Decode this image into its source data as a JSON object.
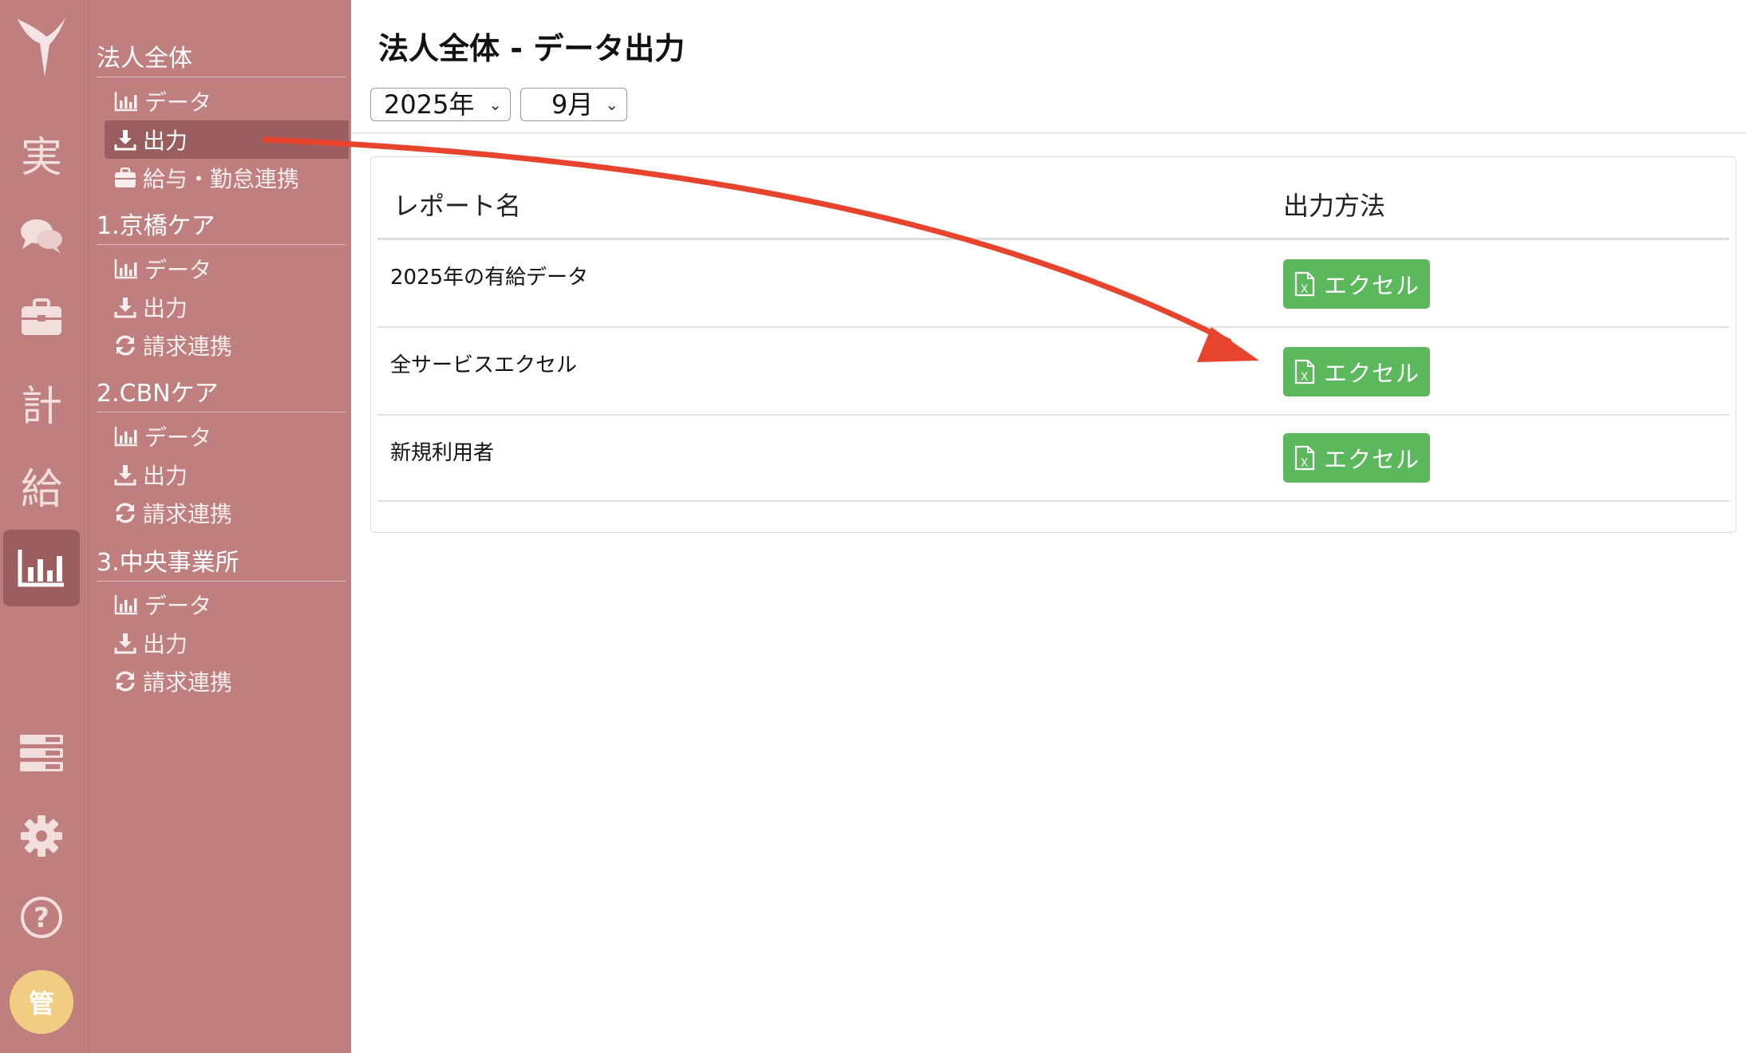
{
  "rail": {
    "items": [
      {
        "glyph": "実",
        "icon": "jitsu-icon"
      },
      {
        "glyph": "",
        "icon": "chat-bubbles-icon"
      },
      {
        "glyph": "",
        "icon": "briefcase-icon"
      },
      {
        "glyph": "計",
        "icon": "kei-icon"
      },
      {
        "glyph": "給",
        "icon": "kyu-icon"
      },
      {
        "glyph": "",
        "icon": "bar-chart-icon"
      },
      {
        "glyph": "",
        "icon": "list-icon"
      },
      {
        "glyph": "",
        "icon": "gear-icon"
      },
      {
        "glyph": "?",
        "icon": "help-icon"
      }
    ],
    "avatar": "管"
  },
  "sidebar": {
    "sections": [
      {
        "title": "法人全体",
        "items": [
          {
            "label": "データ",
            "icon": "bar-chart-icon"
          },
          {
            "label": "出力",
            "icon": "download-icon",
            "active": true
          },
          {
            "label": "給与・勤怠連携",
            "icon": "briefcase-icon"
          }
        ]
      },
      {
        "title": "1.京橋ケア",
        "items": [
          {
            "label": "データ",
            "icon": "bar-chart-icon"
          },
          {
            "label": "出力",
            "icon": "download-icon"
          },
          {
            "label": "請求連携",
            "icon": "refresh-icon"
          }
        ]
      },
      {
        "title": "2.CBNケア",
        "items": [
          {
            "label": "データ",
            "icon": "bar-chart-icon"
          },
          {
            "label": "出力",
            "icon": "download-icon"
          },
          {
            "label": "請求連携",
            "icon": "refresh-icon"
          }
        ]
      },
      {
        "title": "3.中央事業所",
        "items": [
          {
            "label": "データ",
            "icon": "bar-chart-icon"
          },
          {
            "label": "出力",
            "icon": "download-icon"
          },
          {
            "label": "請求連携",
            "icon": "refresh-icon"
          }
        ]
      }
    ]
  },
  "page": {
    "title": "法人全体 - データ出力",
    "year_select": "2025年",
    "month_select": "9月"
  },
  "table": {
    "headers": [
      "レポート名",
      "出力方法"
    ],
    "rows": [
      {
        "name": "2025年の有給データ",
        "button": "エクセル"
      },
      {
        "name": "全サービスエクセル",
        "button": "エクセル"
      },
      {
        "name": "新規利用者",
        "button": "エクセル"
      }
    ]
  },
  "colors": {
    "sidebar_bg": "#c07f7f",
    "sidebar_active": "#9a5e5e",
    "excel_button": "#5cb85c",
    "annotation_arrow": "#e8442d",
    "avatar_bg": "#f0cd82"
  }
}
